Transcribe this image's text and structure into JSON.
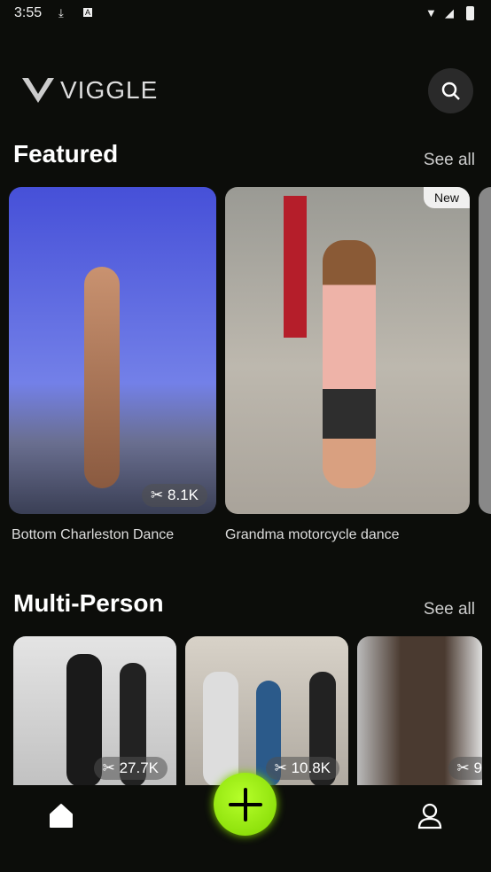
{
  "status": {
    "time": "3:55"
  },
  "header": {
    "logo": "VIGGLE"
  },
  "featured": {
    "title": "Featured",
    "see_all": "See all",
    "items": [
      {
        "caption": "Bottom Charleston Dance",
        "count": "8.1K"
      },
      {
        "caption": "Grandma motorcycle dance",
        "badge": "New"
      }
    ]
  },
  "multi": {
    "title": "Multi-Person",
    "see_all": "See all",
    "items": [
      {
        "count": "27.7K"
      },
      {
        "count": "10.8K"
      },
      {
        "count": "9"
      }
    ]
  },
  "colors": {
    "accent": "#9be615",
    "background": "#0c0d0a"
  }
}
